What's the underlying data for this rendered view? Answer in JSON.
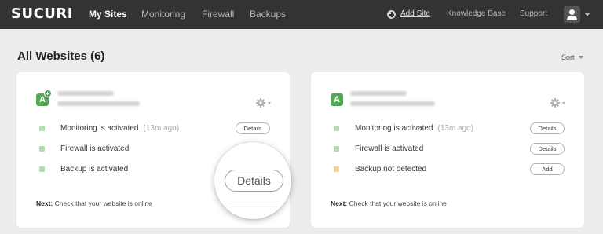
{
  "header": {
    "logo": "SUCURI",
    "nav": [
      "My Sites",
      "Monitoring",
      "Firewall",
      "Backups"
    ],
    "active_nav": "My Sites",
    "add_site": "Add Site",
    "knowledge_base": "Knowledge Base",
    "support": "Support",
    "icons": [
      "plus-circle-icon",
      "user-icon",
      "chevron-down-icon"
    ]
  },
  "page": {
    "title": "All Websites (6)",
    "sort_label": "Sort"
  },
  "cards": [
    {
      "badge": "A",
      "rows": [
        {
          "text": "Monitoring is activated",
          "time": "(13m ago)",
          "button": "Details",
          "status": "ok"
        },
        {
          "text": "Firewall is activated",
          "time": "",
          "button": "",
          "status": "ok"
        },
        {
          "text": "Backup is activated",
          "time": "",
          "button": "",
          "status": "ok"
        }
      ],
      "next_label": "Next:",
      "next_text": "Check that your website is online",
      "magnified_button": "Details"
    },
    {
      "badge": "A",
      "rows": [
        {
          "text": "Monitoring is activated",
          "time": "(13m ago)",
          "button": "Details",
          "status": "ok"
        },
        {
          "text": "Firewall is activated",
          "time": "",
          "button": "Details",
          "status": "ok"
        },
        {
          "text": "Backup not detected",
          "time": "",
          "button": "Add",
          "status": "warn"
        }
      ],
      "next_label": "Next:",
      "next_text": "Check that your website is online"
    }
  ],
  "colors": {
    "topbar": "#333333",
    "badge_green": "#52a857",
    "status_ok": "#b6dbb3",
    "status_warn": "#f4d393",
    "page_bg": "#ececec"
  }
}
